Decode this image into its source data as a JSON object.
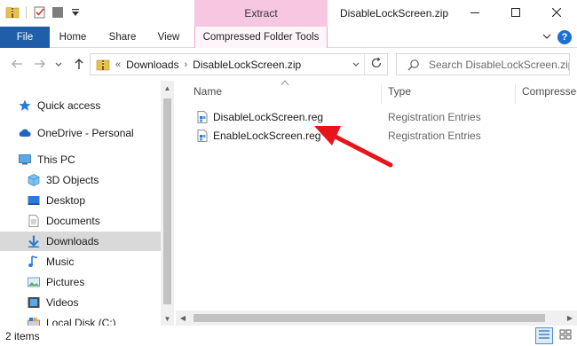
{
  "window": {
    "title": "DisableLockScreen.zip",
    "contextual_tab_group": "Extract"
  },
  "ribbon": {
    "tabs": [
      {
        "label": "File"
      },
      {
        "label": "Home"
      },
      {
        "label": "Share"
      },
      {
        "label": "View"
      },
      {
        "label": "Compressed Folder Tools"
      }
    ],
    "help_label": "?"
  },
  "address": {
    "overflow": "«",
    "crumbs": [
      "Downloads",
      "DisableLockScreen.zip"
    ],
    "separator": "›"
  },
  "search": {
    "placeholder": "Search DisableLockScreen.zip"
  },
  "navigation": {
    "quick_access": "Quick access",
    "onedrive": "OneDrive - Personal",
    "this_pc": "This PC",
    "items": [
      {
        "label": "3D Objects"
      },
      {
        "label": "Desktop"
      },
      {
        "label": "Documents"
      },
      {
        "label": "Downloads"
      },
      {
        "label": "Music"
      },
      {
        "label": "Pictures"
      },
      {
        "label": "Videos"
      },
      {
        "label": "Local Disk (C:)"
      }
    ],
    "selected": "Downloads"
  },
  "columns": {
    "name": "Name",
    "type": "Type",
    "compressed": "Compressed"
  },
  "files": [
    {
      "name": "DisableLockScreen.reg",
      "type": "Registration Entries"
    },
    {
      "name": "EnableLockScreen.reg",
      "type": "Registration Entries"
    }
  ],
  "status": {
    "item_count": "2 items"
  },
  "colors": {
    "file_tab": "#1f5ea8",
    "extract_tab": "#f7c7e1",
    "selected_nav": "#d9d9d9",
    "annotation_arrow": "#e8141b"
  }
}
